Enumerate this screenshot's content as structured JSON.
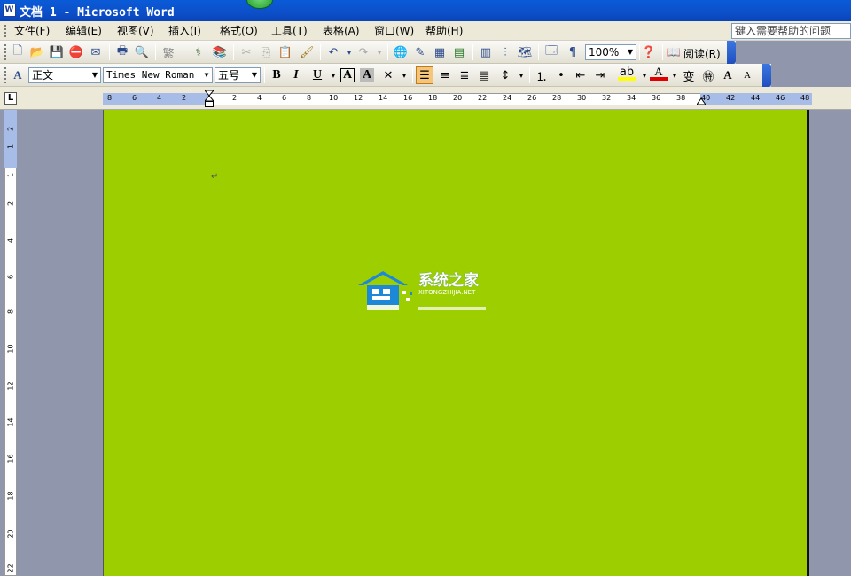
{
  "window": {
    "title": "文档 1 - Microsoft Word"
  },
  "menu": {
    "items": [
      "文件(F)",
      "编辑(E)",
      "视图(V)",
      "插入(I)",
      "格式(O)",
      "工具(T)",
      "表格(A)",
      "窗口(W)",
      "帮助(H)"
    ],
    "help_placeholder": "键入需要帮助的问题"
  },
  "toolbar_standard": {
    "zoom": "100%",
    "read_label": "阅读(R)"
  },
  "toolbar_format": {
    "style": "正文",
    "font": "Times New Roman",
    "size": "五号",
    "bold": "B",
    "italic": "I",
    "underline": "U",
    "char_border": "A",
    "char_shading": "A"
  },
  "ruler": {
    "corner": "L",
    "h_numbers": [
      "8",
      "6",
      "4",
      "2",
      "2",
      "4",
      "6",
      "8",
      "10",
      "12",
      "14",
      "16",
      "18",
      "20",
      "22",
      "24",
      "26",
      "28",
      "30",
      "32",
      "34",
      "36",
      "38",
      "40",
      "42",
      "44",
      "46",
      "48"
    ],
    "v_numbers": [
      "2",
      "1",
      "1",
      "2",
      "4",
      "6",
      "8",
      "10",
      "12",
      "14",
      "16",
      "18",
      "20",
      "22"
    ]
  },
  "document": {
    "page_color": "#9dcf00",
    "watermark": {
      "cn": "系统之家",
      "en": "XITONGZHIJIA.NET"
    }
  },
  "icons": [
    "new-document-icon",
    "open-icon",
    "save-icon",
    "permission-icon",
    "email-icon",
    "print-icon",
    "print-preview-icon",
    "spelling-icon",
    "research-icon",
    "cut-icon",
    "copy-icon",
    "paste-icon",
    "format-painter-icon",
    "undo-icon",
    "redo-icon",
    "hyperlink-icon",
    "tables-borders-icon",
    "insert-table-icon",
    "insert-excel-icon",
    "columns-icon",
    "drawing-icon",
    "document-map-icon",
    "show-hide-icon",
    "help-icon"
  ]
}
